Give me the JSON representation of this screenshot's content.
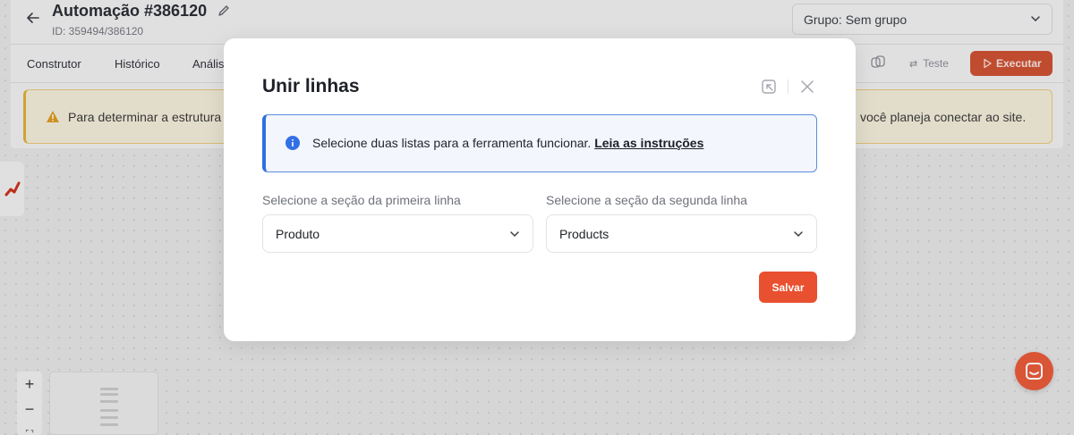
{
  "header": {
    "title": "Automação #386120",
    "id_label": "ID: 359494/386120",
    "group_select": "Grupo: Sem grupo"
  },
  "tabs": [
    {
      "label": "Construtor"
    },
    {
      "label": "Histórico"
    },
    {
      "label": "Anális"
    }
  ],
  "toolbar": {
    "test_label": "Teste",
    "run_label": "Executar"
  },
  "warning": {
    "text_left": "Para determinar a estrutura",
    "text_right": "você planeja conectar ao site."
  },
  "zoom": {
    "in_label": "+",
    "out_label": "−"
  },
  "modal": {
    "title": "Unir linhas",
    "info_text": "Selecione duas listas para a ferramenta funcionar.",
    "info_link": "Leia as instruções",
    "first_label": "Selecione a seção da primeira linha",
    "first_value": "Produto",
    "second_label": "Selecione a seção da segunda linha",
    "second_value": "Products",
    "save_label": "Salvar"
  },
  "colors": {
    "accent": "#e8502f",
    "info_border": "#2f6fe0",
    "warning_border": "#dfae3a"
  },
  "icons": [
    "back-arrow-icon",
    "pencil-icon",
    "chevron-down-icon",
    "copy-icon",
    "duplicate-icon",
    "swap-icon",
    "play-icon",
    "warning-icon",
    "chart-tool-icon",
    "expand-icon",
    "close-icon",
    "info-icon",
    "chat-icon",
    "fit-view-icon"
  ]
}
